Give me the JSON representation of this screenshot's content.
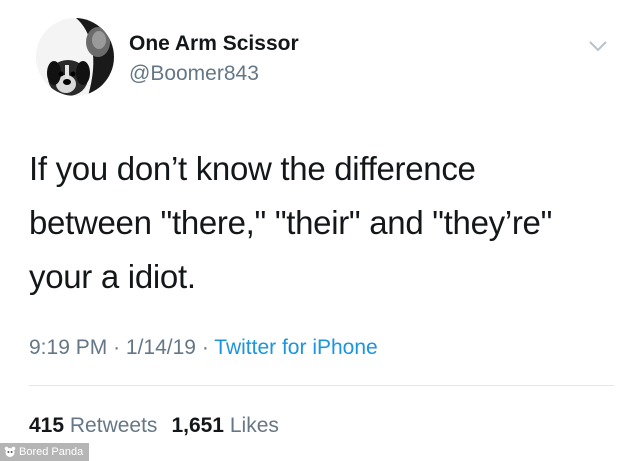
{
  "user": {
    "display_name": "One Arm Scissor",
    "handle": "@Boomer843",
    "avatar_icon": "dog-avatar"
  },
  "menu": {
    "icon": "chevron-down-icon"
  },
  "tweet": {
    "lines": [
      "If you don’t know the difference",
      "between \"there,\" \"their\" and \"they’re\"",
      "your a idiot."
    ]
  },
  "meta": {
    "time": "9:19 PM",
    "separator": "·",
    "date": "1/14/19",
    "source": "Twitter for iPhone"
  },
  "stats": {
    "retweets_count": "415",
    "retweets_label": "Retweets",
    "likes_count": "1,651",
    "likes_label": "Likes"
  },
  "watermark": {
    "text": "Bored Panda"
  },
  "colors": {
    "text": "#14171a",
    "secondary": "#657786",
    "link": "#1b95e0",
    "divider": "#e1e8ed"
  }
}
